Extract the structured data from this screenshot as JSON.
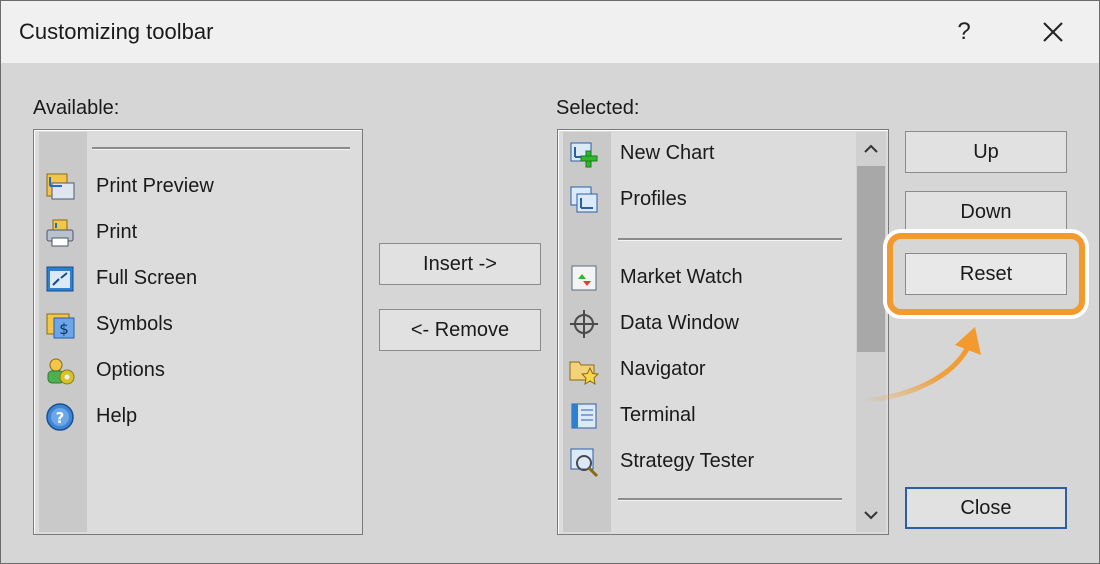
{
  "dialog": {
    "title": "Customizing toolbar",
    "help_label": "?",
    "close_icon": "close-icon"
  },
  "available": {
    "label": "Available:",
    "items": [
      {
        "label": "Print Preview",
        "icon": "print-preview-icon"
      },
      {
        "label": "Print",
        "icon": "printer-icon"
      },
      {
        "label": "Full Screen",
        "icon": "full-screen-icon"
      },
      {
        "label": "Symbols",
        "icon": "symbols-icon"
      },
      {
        "label": "Options",
        "icon": "options-icon"
      },
      {
        "label": "Help",
        "icon": "help-icon"
      }
    ]
  },
  "middle": {
    "insert_label": "Insert ->",
    "remove_label": "<- Remove"
  },
  "selected": {
    "label": "Selected:",
    "items": [
      {
        "label": "New Chart",
        "icon": "new-chart-icon"
      },
      {
        "label": "Profiles",
        "icon": "profiles-icon"
      },
      {
        "label": "Market Watch",
        "icon": "market-watch-icon"
      },
      {
        "label": "Data Window",
        "icon": "data-window-icon"
      },
      {
        "label": "Navigator",
        "icon": "navigator-icon"
      },
      {
        "label": "Terminal",
        "icon": "terminal-icon"
      },
      {
        "label": "Strategy Tester",
        "icon": "strategy-tester-icon"
      }
    ]
  },
  "side": {
    "up_label": "Up",
    "down_label": "Down",
    "reset_label": "Reset",
    "close_label": "Close"
  },
  "colors": {
    "highlight": "#f29a2e",
    "default_button_border": "#2a5fa8"
  }
}
